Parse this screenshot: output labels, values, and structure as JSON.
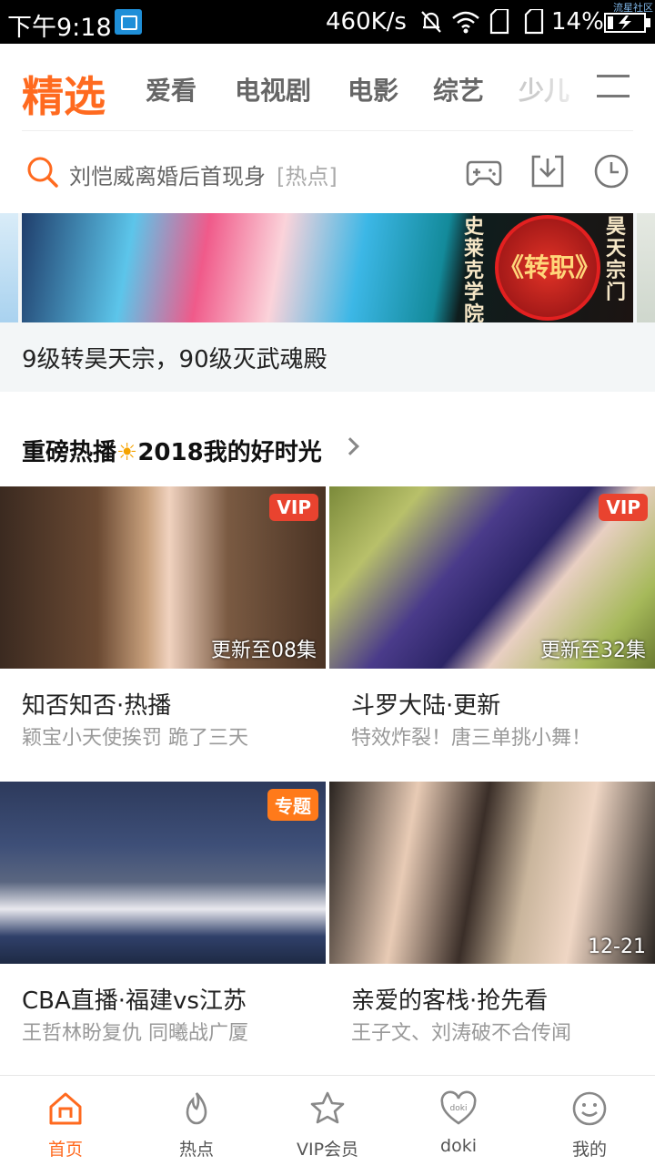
{
  "status_bar": {
    "time": "下午9:18",
    "network_speed": "460K/s",
    "battery_percent": "14%",
    "watermark": "流星社区",
    "icons": [
      "screenshot-icon",
      "mute-bell-icon",
      "wifi-icon",
      "sim1-icon",
      "sim2-icon",
      "battery-charging-icon"
    ]
  },
  "top_nav": {
    "tabs": [
      {
        "label": "精选",
        "active": true
      },
      {
        "label": "爱看",
        "active": false
      },
      {
        "label": "电视剧",
        "active": false
      },
      {
        "label": "电影",
        "active": false
      },
      {
        "label": "综艺",
        "active": false
      },
      {
        "label": "少儿",
        "active": false
      }
    ],
    "menu_icon": "hamburger-icon",
    "accent_color": "#ff6a1f"
  },
  "search": {
    "query": "刘恺威离婚后首现身",
    "hot_tag": "[热点]",
    "icons": [
      "game-controller-icon",
      "download-icon",
      "history-clock-icon"
    ]
  },
  "banner": {
    "seal_text": "《转职》",
    "left_vertical_text": "史莱克学院",
    "right_vertical_text": "昊天宗门",
    "caption": "9级转昊天宗，90级灭武魂殿"
  },
  "section": {
    "title_part1": "重磅热播",
    "title_part2": "2018我的好时光"
  },
  "cards": [
    {
      "badge": "VIP",
      "episode": "更新至08集",
      "title": "知否知否·热播",
      "subtitle": "颖宝小天使挨罚 跪了三天"
    },
    {
      "badge": "VIP",
      "episode": "更新至32集",
      "title": "斗罗大陆·更新",
      "subtitle": "特效炸裂！唐三单挑小舞！"
    },
    {
      "badge": "专题",
      "episode": "",
      "title": "CBA直播·福建vs江苏",
      "subtitle": "王哲林盼复仇 同曦战广厦"
    },
    {
      "badge": "",
      "episode": "12-21",
      "title": "亲爱的客栈·抢先看",
      "subtitle": "王子文、刘涛破不合传闻"
    }
  ],
  "bottom_nav": {
    "items": [
      {
        "label": "首页",
        "icon": "home-icon",
        "active": true
      },
      {
        "label": "热点",
        "icon": "flame-icon",
        "active": false
      },
      {
        "label": "VIP会员",
        "icon": "vip-crown-icon",
        "active": false
      },
      {
        "label": "doki",
        "icon": "doki-heart-icon",
        "active": false
      },
      {
        "label": "我的",
        "icon": "smile-face-icon",
        "active": false
      }
    ],
    "notification_color": "#ff7a1a"
  }
}
